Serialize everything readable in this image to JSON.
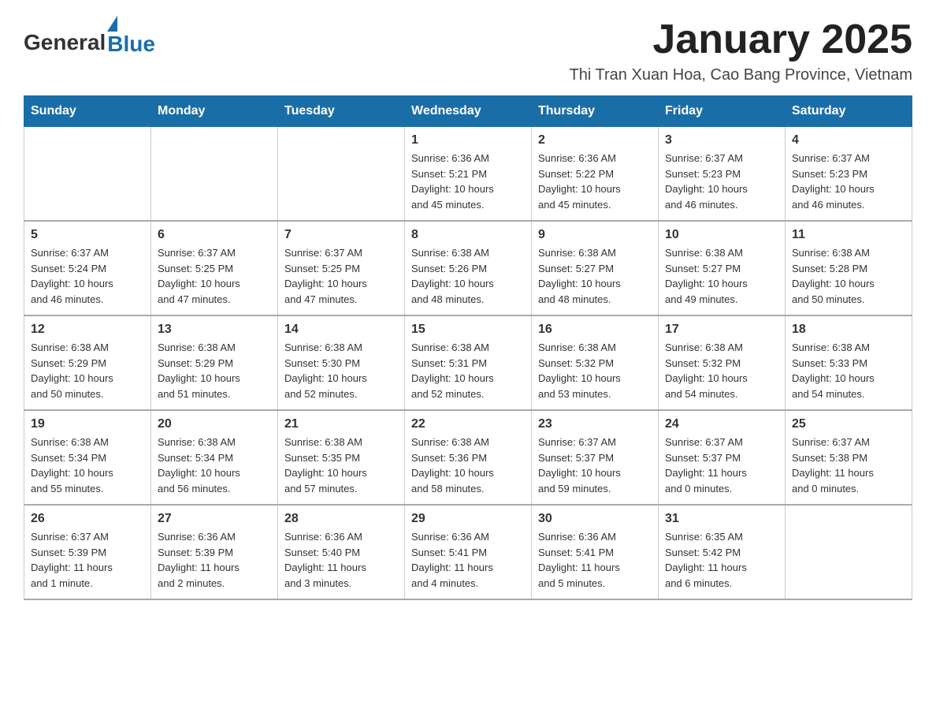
{
  "header": {
    "logo_general": "General",
    "logo_blue": "Blue",
    "title": "January 2025",
    "subtitle": "Thi Tran Xuan Hoa, Cao Bang Province, Vietnam"
  },
  "calendar": {
    "days_of_week": [
      "Sunday",
      "Monday",
      "Tuesday",
      "Wednesday",
      "Thursday",
      "Friday",
      "Saturday"
    ],
    "weeks": [
      [
        {
          "day": "",
          "info": ""
        },
        {
          "day": "",
          "info": ""
        },
        {
          "day": "",
          "info": ""
        },
        {
          "day": "1",
          "info": "Sunrise: 6:36 AM\nSunset: 5:21 PM\nDaylight: 10 hours\nand 45 minutes."
        },
        {
          "day": "2",
          "info": "Sunrise: 6:36 AM\nSunset: 5:22 PM\nDaylight: 10 hours\nand 45 minutes."
        },
        {
          "day": "3",
          "info": "Sunrise: 6:37 AM\nSunset: 5:23 PM\nDaylight: 10 hours\nand 46 minutes."
        },
        {
          "day": "4",
          "info": "Sunrise: 6:37 AM\nSunset: 5:23 PM\nDaylight: 10 hours\nand 46 minutes."
        }
      ],
      [
        {
          "day": "5",
          "info": "Sunrise: 6:37 AM\nSunset: 5:24 PM\nDaylight: 10 hours\nand 46 minutes."
        },
        {
          "day": "6",
          "info": "Sunrise: 6:37 AM\nSunset: 5:25 PM\nDaylight: 10 hours\nand 47 minutes."
        },
        {
          "day": "7",
          "info": "Sunrise: 6:37 AM\nSunset: 5:25 PM\nDaylight: 10 hours\nand 47 minutes."
        },
        {
          "day": "8",
          "info": "Sunrise: 6:38 AM\nSunset: 5:26 PM\nDaylight: 10 hours\nand 48 minutes."
        },
        {
          "day": "9",
          "info": "Sunrise: 6:38 AM\nSunset: 5:27 PM\nDaylight: 10 hours\nand 48 minutes."
        },
        {
          "day": "10",
          "info": "Sunrise: 6:38 AM\nSunset: 5:27 PM\nDaylight: 10 hours\nand 49 minutes."
        },
        {
          "day": "11",
          "info": "Sunrise: 6:38 AM\nSunset: 5:28 PM\nDaylight: 10 hours\nand 50 minutes."
        }
      ],
      [
        {
          "day": "12",
          "info": "Sunrise: 6:38 AM\nSunset: 5:29 PM\nDaylight: 10 hours\nand 50 minutes."
        },
        {
          "day": "13",
          "info": "Sunrise: 6:38 AM\nSunset: 5:29 PM\nDaylight: 10 hours\nand 51 minutes."
        },
        {
          "day": "14",
          "info": "Sunrise: 6:38 AM\nSunset: 5:30 PM\nDaylight: 10 hours\nand 52 minutes."
        },
        {
          "day": "15",
          "info": "Sunrise: 6:38 AM\nSunset: 5:31 PM\nDaylight: 10 hours\nand 52 minutes."
        },
        {
          "day": "16",
          "info": "Sunrise: 6:38 AM\nSunset: 5:32 PM\nDaylight: 10 hours\nand 53 minutes."
        },
        {
          "day": "17",
          "info": "Sunrise: 6:38 AM\nSunset: 5:32 PM\nDaylight: 10 hours\nand 54 minutes."
        },
        {
          "day": "18",
          "info": "Sunrise: 6:38 AM\nSunset: 5:33 PM\nDaylight: 10 hours\nand 54 minutes."
        }
      ],
      [
        {
          "day": "19",
          "info": "Sunrise: 6:38 AM\nSunset: 5:34 PM\nDaylight: 10 hours\nand 55 minutes."
        },
        {
          "day": "20",
          "info": "Sunrise: 6:38 AM\nSunset: 5:34 PM\nDaylight: 10 hours\nand 56 minutes."
        },
        {
          "day": "21",
          "info": "Sunrise: 6:38 AM\nSunset: 5:35 PM\nDaylight: 10 hours\nand 57 minutes."
        },
        {
          "day": "22",
          "info": "Sunrise: 6:38 AM\nSunset: 5:36 PM\nDaylight: 10 hours\nand 58 minutes."
        },
        {
          "day": "23",
          "info": "Sunrise: 6:37 AM\nSunset: 5:37 PM\nDaylight: 10 hours\nand 59 minutes."
        },
        {
          "day": "24",
          "info": "Sunrise: 6:37 AM\nSunset: 5:37 PM\nDaylight: 11 hours\nand 0 minutes."
        },
        {
          "day": "25",
          "info": "Sunrise: 6:37 AM\nSunset: 5:38 PM\nDaylight: 11 hours\nand 0 minutes."
        }
      ],
      [
        {
          "day": "26",
          "info": "Sunrise: 6:37 AM\nSunset: 5:39 PM\nDaylight: 11 hours\nand 1 minute."
        },
        {
          "day": "27",
          "info": "Sunrise: 6:36 AM\nSunset: 5:39 PM\nDaylight: 11 hours\nand 2 minutes."
        },
        {
          "day": "28",
          "info": "Sunrise: 6:36 AM\nSunset: 5:40 PM\nDaylight: 11 hours\nand 3 minutes."
        },
        {
          "day": "29",
          "info": "Sunrise: 6:36 AM\nSunset: 5:41 PM\nDaylight: 11 hours\nand 4 minutes."
        },
        {
          "day": "30",
          "info": "Sunrise: 6:36 AM\nSunset: 5:41 PM\nDaylight: 11 hours\nand 5 minutes."
        },
        {
          "day": "31",
          "info": "Sunrise: 6:35 AM\nSunset: 5:42 PM\nDaylight: 11 hours\nand 6 minutes."
        },
        {
          "day": "",
          "info": ""
        }
      ]
    ]
  }
}
